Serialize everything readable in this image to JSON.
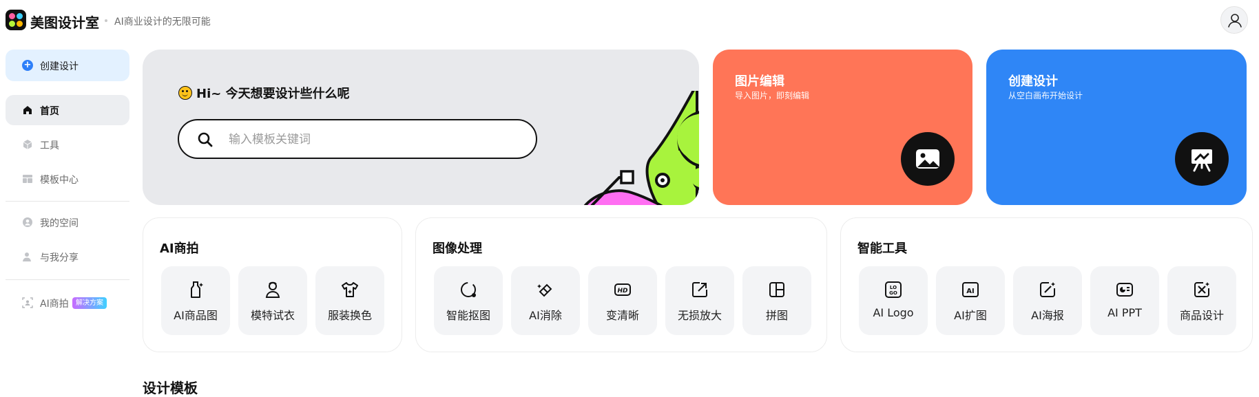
{
  "header": {
    "brand": "美图设计室",
    "slogan": "AI商业设计的无限可能",
    "logo_icon": "meitu-logo-icon",
    "avatar_icon": "user-icon"
  },
  "sidebar": {
    "create_label": "创建设计",
    "items": [
      {
        "label": "首页",
        "icon": "home-icon",
        "active": true
      },
      {
        "label": "工具",
        "icon": "cube-icon"
      },
      {
        "label": "模板中心",
        "icon": "template-icon"
      },
      {
        "label": "我的空间",
        "icon": "person-circle-icon"
      },
      {
        "label": "与我分享",
        "icon": "share-user-icon"
      },
      {
        "label": "AI商拍",
        "icon": "ai-scan-icon",
        "badge": "解决方案"
      }
    ]
  },
  "hero": {
    "greeting": "Hi~ 今天想要设计些什么呢",
    "search_placeholder": "输入模板关键词"
  },
  "promos": [
    {
      "title": "图片编辑",
      "subtitle": "导入图片，即刻编辑",
      "color": "#ff7557",
      "icon": "image-icon"
    },
    {
      "title": "创建设计",
      "subtitle": "从空白画布开始设计",
      "color": "#2f86f6",
      "icon": "easel-icon"
    }
  ],
  "sections": [
    {
      "title": "AI商拍",
      "tools": [
        "AI商品图",
        "模特试衣",
        "服装换色"
      ]
    },
    {
      "title": "图像处理",
      "tools": [
        "智能抠图",
        "AI消除",
        "变清晰",
        "无损放大",
        "拼图"
      ]
    },
    {
      "title": "智能工具",
      "tools": [
        "AI Logo",
        "AI扩图",
        "AI海报",
        "AI PPT",
        "商品设计"
      ]
    }
  ],
  "templates_title": "设计模板"
}
